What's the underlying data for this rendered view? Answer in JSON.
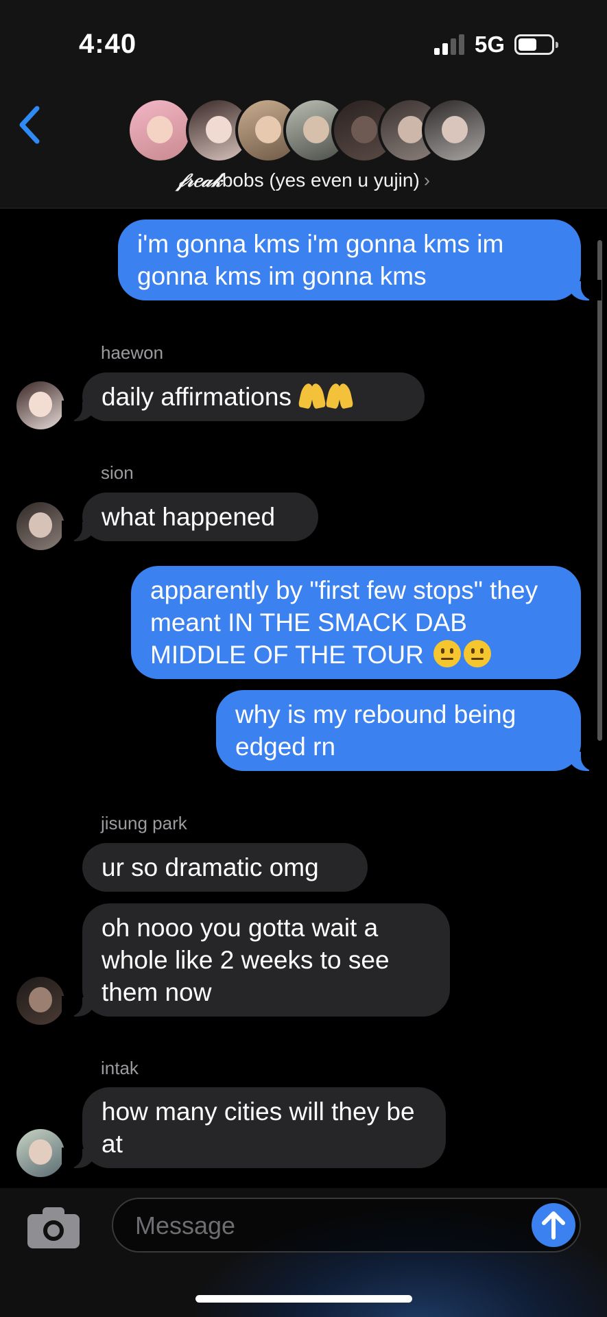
{
  "status_bar": {
    "time": "4:40",
    "network": "5G",
    "signal_bars": 2,
    "battery_level_percent": 50
  },
  "header": {
    "back_icon": "chevron-left-icon",
    "group_name_styled": "𝒻𝓇𝑒𝒶𝓀",
    "group_name_rest": "bobs (yes even u yujin)",
    "chevron": "›",
    "member_avatar_count": 7
  },
  "messages": [
    {
      "type": "sent",
      "text": "i'm gonna kms i'm gonna kms im gonna kms im gonna kms"
    },
    {
      "type": "received",
      "sender": "haewon",
      "text": "daily affirmations"
    },
    {
      "type": "received",
      "sender": "sion",
      "text": "what happened"
    },
    {
      "type": "sent",
      "text": "apparently by \"first few stops\" they meant IN THE SMACK DAB MIDDLE OF THE TOUR"
    },
    {
      "type": "sent",
      "text": "why is my rebound being edged rn"
    },
    {
      "type": "received",
      "sender": "jisung park",
      "text": "ur so dramatic omg"
    },
    {
      "type": "received",
      "sender": "jisung park",
      "text": "oh nooo you gotta wait a whole like 2 weeks to see them now"
    },
    {
      "type": "received",
      "sender": "intak",
      "text": "how many cities will they be at"
    }
  ],
  "input": {
    "placeholder": "Message",
    "camera_icon": "camera-icon",
    "send_icon": "arrow-up-icon"
  },
  "colors": {
    "sent_bubble": "#3b82f0",
    "received_bubble": "#262629",
    "background": "#000000",
    "header": "#141414"
  }
}
